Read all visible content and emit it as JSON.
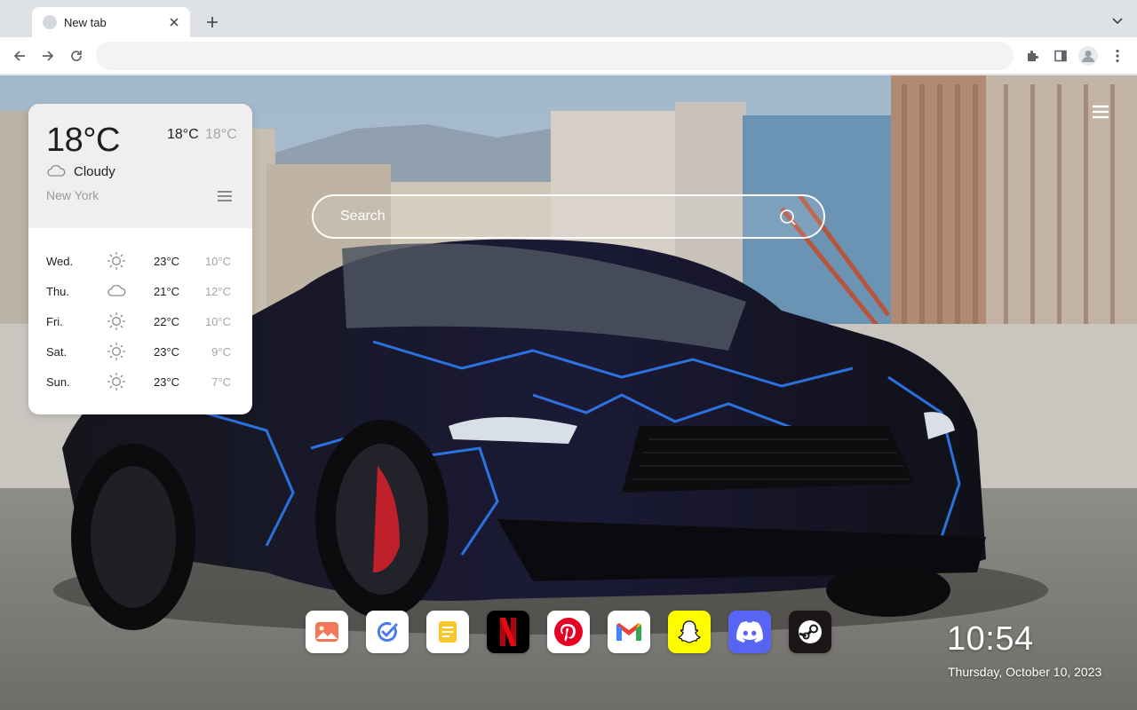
{
  "browser": {
    "tab_title": "New tab",
    "omnibox_value": "",
    "icons": {
      "favicon": "globe-icon",
      "close": "close-icon",
      "new_tab": "plus-icon",
      "tab_search": "chevron-down-icon",
      "back": "back-arrow-icon",
      "forward": "forward-arrow-icon",
      "reload": "reload-icon",
      "extensions": "puzzle-icon",
      "side_panel": "side-panel-icon",
      "profile": "avatar-icon",
      "menu": "kebab-menu-icon"
    }
  },
  "page": {
    "menu_icon": "hamburger-icon",
    "search": {
      "placeholder": "Search",
      "icon": "search-icon"
    },
    "weather": {
      "current_temp": "18°C",
      "high": "18°C",
      "low": "18°C",
      "condition": "Cloudy",
      "condition_icon": "cloud-icon",
      "city": "New York",
      "list_icon": "list-icon",
      "forecast": [
        {
          "day": "Wed.",
          "icon": "sun-icon",
          "high": "23°C",
          "low": "10°C"
        },
        {
          "day": "Thu.",
          "icon": "cloud-icon",
          "high": "21°C",
          "low": "12°C"
        },
        {
          "day": "Fri.",
          "icon": "sun-icon",
          "high": "22°C",
          "low": "10°C"
        },
        {
          "day": "Sat.",
          "icon": "sun-icon",
          "high": "23°C",
          "low": "9°C"
        },
        {
          "day": "Sun.",
          "icon": "sun-icon",
          "high": "23°C",
          "low": "7°C"
        }
      ]
    },
    "dock": [
      {
        "name": "gallery",
        "icon": "gallery-icon"
      },
      {
        "name": "tasks",
        "icon": "check-icon"
      },
      {
        "name": "notes",
        "icon": "notes-icon"
      },
      {
        "name": "netflix",
        "icon": "netflix-icon"
      },
      {
        "name": "pinterest",
        "icon": "pinterest-icon"
      },
      {
        "name": "gmail",
        "icon": "gmail-icon"
      },
      {
        "name": "snapchat",
        "icon": "snapchat-icon"
      },
      {
        "name": "discord",
        "icon": "discord-icon"
      },
      {
        "name": "steam",
        "icon": "steam-icon"
      }
    ],
    "clock": {
      "time": "10:54",
      "date": "Thursday, October 10, 2023"
    }
  },
  "colors": {
    "chrome_bg": "#dee1e6",
    "toolbar_bg": "#ffffff",
    "omnibox_bg": "#f1f3f4",
    "widget_header_bg": "#efefef",
    "muted_text": "#a6a6a6",
    "netflix_red": "#e50914",
    "pinterest_red": "#e60023",
    "snapchat_yellow": "#fffc00",
    "discord_blurple": "#5865f2"
  }
}
